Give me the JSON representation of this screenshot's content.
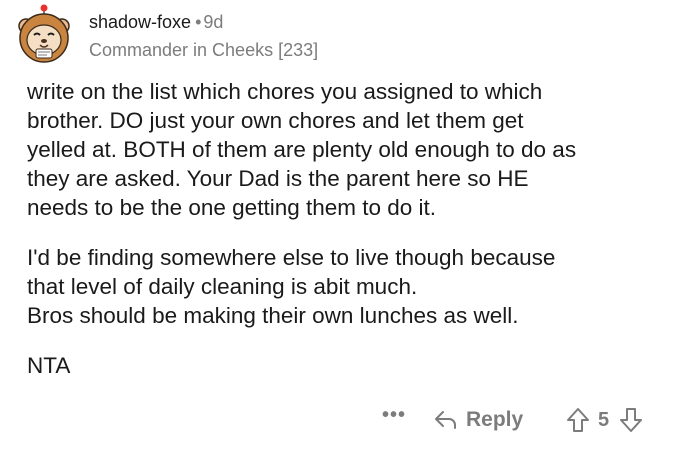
{
  "author": {
    "username": "shadow-foxe",
    "separator": "•",
    "age": "9d",
    "flair": "Commander in Cheeks [233]",
    "avatar_icon": "hamster-avatar-icon"
  },
  "comment": {
    "paragraphs": [
      "write on the list which chores you assigned to which\nbrother.  DO just your own chores and let them get\nyelled at.  BOTH of them are plenty old enough to do as\nthey are asked.  Your Dad is the parent here so HE\nneeds to be the one getting them to do it.",
      "I'd be finding somewhere else to live though because\nthat level of daily cleaning is abit much.\nBros should be making their own lunches as well.",
      "NTA"
    ]
  },
  "actions": {
    "more_label": "•••",
    "reply_label": "Reply",
    "score": "5",
    "icons": {
      "reply": "reply-arrow-icon",
      "upvote": "upvote-arrow-icon",
      "downvote": "downvote-arrow-icon"
    }
  },
  "colors": {
    "text": "#1a1a1b",
    "meta": "#7c7c7c",
    "background": "#ffffff"
  }
}
